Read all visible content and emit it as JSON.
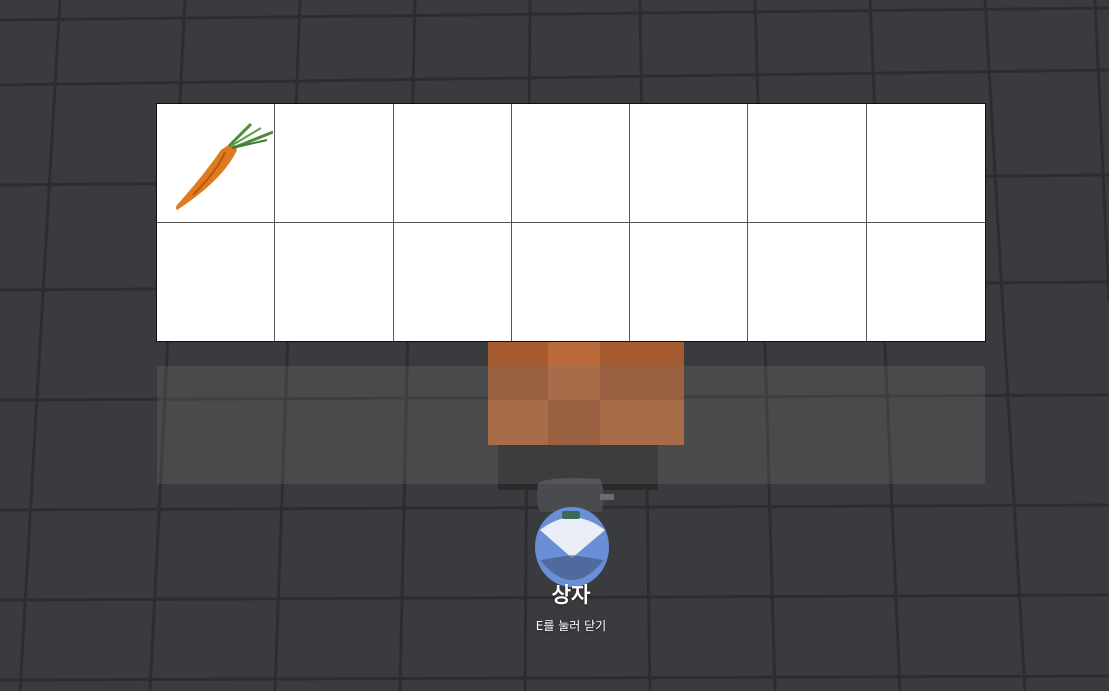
{
  "inventory": {
    "columns": 7,
    "rows": 2,
    "slots": [
      {
        "item": "carrot-icon"
      },
      {
        "item": null
      },
      {
        "item": null
      },
      {
        "item": null
      },
      {
        "item": null
      },
      {
        "item": null
      },
      {
        "item": null
      },
      {
        "item": null
      },
      {
        "item": null
      },
      {
        "item": null
      },
      {
        "item": null
      },
      {
        "item": null
      },
      {
        "item": null
      },
      {
        "item": null
      }
    ]
  },
  "prompt": {
    "title": "상자",
    "hint": "E를 눌러 닫기"
  },
  "colors": {
    "ground": "#3a3b3e",
    "grid_line": "#2b2c2f",
    "slot_background": "#ffffff",
    "carrot": "#e07a1f",
    "carrot_leaves": "#4f8a3a",
    "crate_orange": "#c9743a",
    "player_blue": "#6a8fd6"
  }
}
